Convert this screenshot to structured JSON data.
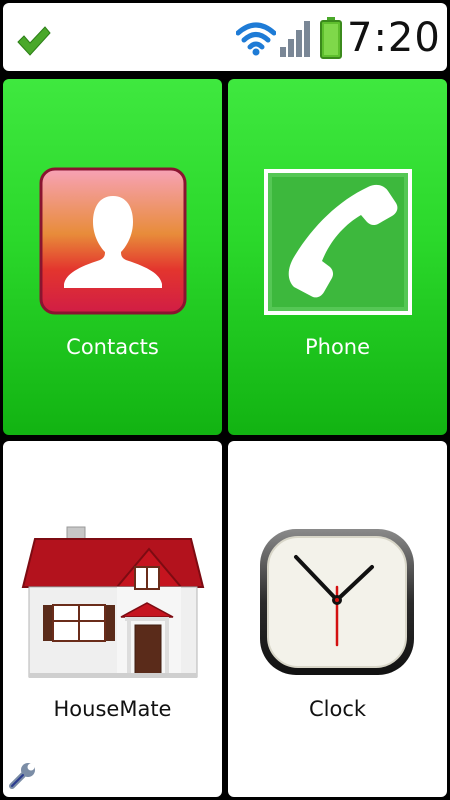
{
  "status_bar": {
    "time": "7:20",
    "icons": [
      "check-icon",
      "wifi-icon",
      "signal-icon",
      "battery-icon"
    ]
  },
  "tiles": [
    {
      "label": "Contacts",
      "icon": "contacts-icon",
      "color": "#2bd82b"
    },
    {
      "label": "Phone",
      "icon": "phone-icon",
      "color": "#2bd82b"
    },
    {
      "label": "HouseMate",
      "icon": "house-icon",
      "color": "#ffffff"
    },
    {
      "label": "Clock",
      "icon": "clock-icon",
      "color": "#ffffff"
    }
  ],
  "footer": {
    "icon": "wrench-icon"
  }
}
